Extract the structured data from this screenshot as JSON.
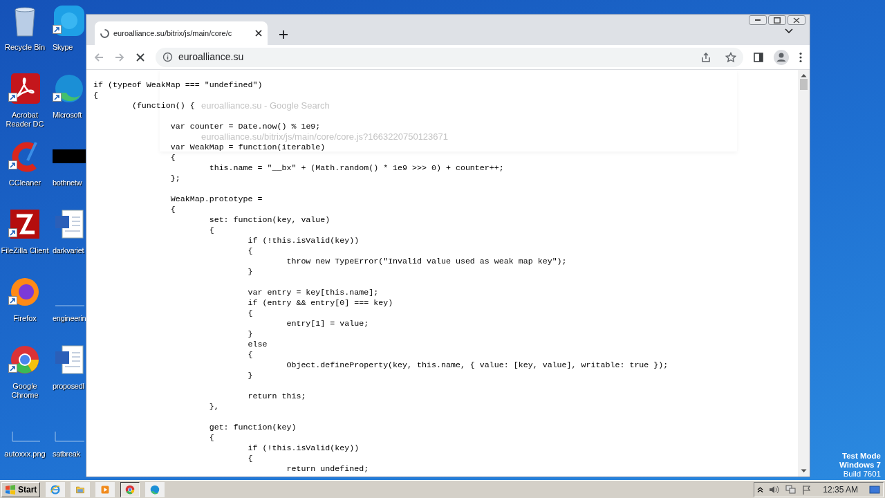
{
  "desktop": {
    "columns": [
      [
        {
          "label": "Recycle Bin",
          "shortcut": false
        },
        {
          "label": "Acrobat Reader DC",
          "shortcut": true
        },
        {
          "label": "CCleaner",
          "shortcut": true
        },
        {
          "label": "FileZilla Client",
          "shortcut": true
        },
        {
          "label": "Firefox",
          "shortcut": true
        },
        {
          "label": "Google Chrome",
          "shortcut": true
        },
        {
          "label": "autoxxx.png",
          "shortcut": false
        }
      ],
      [
        {
          "label": "Skype",
          "shortcut": true
        },
        {
          "label": "Microsoft",
          "shortcut": true
        },
        {
          "label": "bothnetw",
          "shortcut": false
        },
        {
          "label": "darkvariet",
          "shortcut": false
        },
        {
          "label": "engineerin",
          "shortcut": false
        },
        {
          "label": "proposedl",
          "shortcut": false
        },
        {
          "label": "satbreak",
          "shortcut": false
        }
      ]
    ],
    "os_notice": [
      "Test Mode",
      "Windows 7",
      "Build 7601"
    ]
  },
  "browser": {
    "tab": {
      "title": "euroalliance.su/bitrix/js/main/core/c",
      "loading": true
    },
    "address": "euroalliance.su",
    "suggestions": [
      "euroalliance.su - Google Search",
      "euroalliance.su/bitrix/js/main/core/core.js?1663220750123671"
    ],
    "code_blocks": [
      [
        "if (typeof WeakMap === \"undefined\")",
        "{",
        "\t(function() {"
      ],
      [
        "\t\tvar counter = Date.now() % 1e9;"
      ],
      [
        "\t\tvar WeakMap = function(iterable)",
        "\t\t{",
        "\t\t\tthis.name = \"__bx\" + (Math.random() * 1e9 >>> 0) + counter++;",
        "\t\t};"
      ],
      [
        "\t\tWeakMap.prototype =",
        "\t\t{",
        "\t\t\tset: function(key, value)",
        "\t\t\t{",
        "\t\t\t\tif (!this.isValid(key))",
        "\t\t\t\t{",
        "\t\t\t\t\tthrow new TypeError(\"Invalid value used as weak map key\");",
        "\t\t\t\t}"
      ],
      [
        "\t\t\t\tvar entry = key[this.name];",
        "\t\t\t\tif (entry && entry[0] === key)",
        "\t\t\t\t{",
        "\t\t\t\t\tentry[1] = value;",
        "\t\t\t\t}",
        "\t\t\t\telse",
        "\t\t\t\t{",
        "\t\t\t\t\tObject.defineProperty(key, this.name, { value: [key, value], writable: true });",
        "\t\t\t\t}"
      ],
      [
        "\t\t\t\treturn this;",
        "\t\t\t},"
      ],
      [
        "\t\t\tget: function(key)",
        "\t\t\t{",
        "\t\t\t\tif (!this.isValid(key))",
        "\t\t\t\t{",
        "\t\t\t\t\treturn undefined;"
      ]
    ]
  },
  "taskbar": {
    "start": "Start",
    "apps": [
      {
        "selected": false
      },
      {
        "selected": false
      },
      {
        "selected": false
      },
      {
        "selected": true
      },
      {
        "selected": false
      }
    ],
    "clock": "12:35 AM"
  }
}
